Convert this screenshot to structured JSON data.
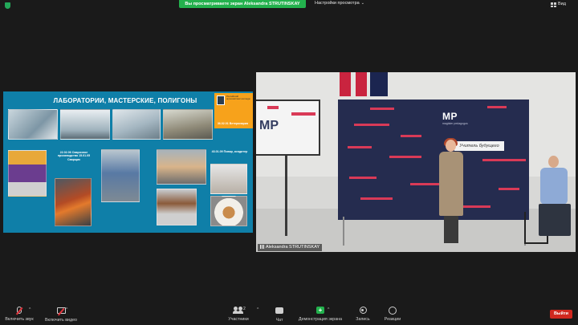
{
  "topbar": {
    "sharing_notice": "Вы просматриваете экран Aleksandra STRUTINSKAY",
    "view_options": "Настройки просмотра",
    "view_button": "Вид"
  },
  "slide": {
    "title": "ЛАБОРАТОРИИ, МАСТЕРСКИЕ, ПОЛИГОНЫ",
    "badge_text": "Российский агрокомплекс колледж",
    "labels": [
      "36.02.01 Ветеринария",
      "22.02.06 Сварочное производство 15.01.05 Сварщик",
      "43.01.09 Повар, кондитер"
    ]
  },
  "camera": {
    "participant_name": "Aleksandra STRUTINSKAY",
    "banner_logo": "MP",
    "banner_sub": "magister pedagogus",
    "sign_text": "Учитель будущего",
    "tv_logo": "MP"
  },
  "toolbar": {
    "unmute": "Включить звук",
    "start_video": "Включить видео",
    "participants": "Участники",
    "participants_count": "2",
    "chat": "Чат",
    "share_screen": "Демонстрация экрана",
    "record": "Запись",
    "reactions": "Реакции",
    "leave": "Выйти"
  },
  "colors": {
    "share_green": "#23b14d",
    "leave_red": "#d0281f",
    "slide_blue": "#0f7fa8",
    "badge_orange": "#f7a21b",
    "banner_navy": "#252c4f",
    "accent_red": "#d93a57"
  }
}
